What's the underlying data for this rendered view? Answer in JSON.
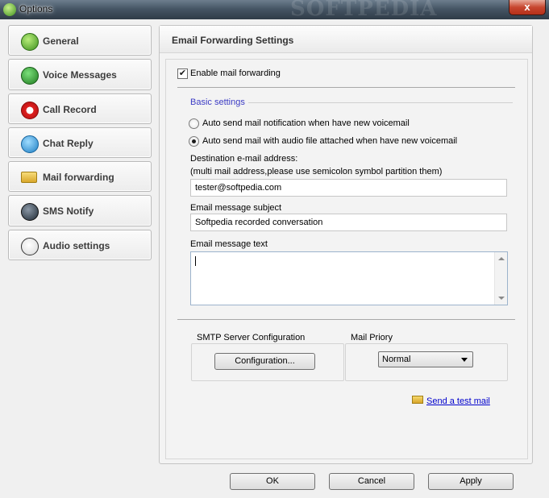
{
  "window": {
    "title": "Options",
    "watermark": "SOFTPEDIA",
    "close_glyph": "x"
  },
  "sidebar": {
    "items": [
      {
        "label": "General",
        "icon": "pm-icon",
        "color": "#3d8f1e"
      },
      {
        "label": "Voice Messages",
        "icon": "phone-icon",
        "color": "#2f8a2a"
      },
      {
        "label": "Call Record",
        "icon": "record-icon",
        "color": "#d11d1d"
      },
      {
        "label": "Chat Reply",
        "icon": "chat-bubble-icon",
        "color": "#2a86c9"
      },
      {
        "label": "Mail forwarding",
        "icon": "mail-forward-icon",
        "color": "#e2b635"
      },
      {
        "label": "SMS Notify",
        "icon": "sms-icon",
        "color": "#2d3b49"
      },
      {
        "label": "Audio settings",
        "icon": "speaker-icon",
        "color": "#3a3a3a"
      }
    ]
  },
  "main": {
    "header_title": "Email Forwarding Settings",
    "enable_forwarding_label": "Enable mail forwarding",
    "enable_forwarding_checked": true,
    "basic_settings_label": "Basic settings",
    "radio_notify_label": "Auto send mail notification when have new voicemail",
    "radio_attach_label": "Auto send mail with audio file attached when have new voicemail",
    "destination_label": "Destination e-mail address:",
    "destination_hint": "(multi mail address,please use semicolon symbol partition them)",
    "destination_value": "tester@softpedia.com",
    "subject_label": "Email message subject",
    "subject_value": "Softpedia recorded conversation",
    "message_label": "Email message text",
    "message_value": "",
    "smtp_label": "SMTP Server Configuration",
    "config_button": "Configuration...",
    "priority_label": "Mail Priory",
    "priority_value": "Normal",
    "test_mail_link": "Send a test mail"
  },
  "footer": {
    "ok": "OK",
    "cancel": "Cancel",
    "apply": "Apply"
  },
  "colors": {
    "accent_blue": "#3b3bc4",
    "link": "#0000cc"
  }
}
